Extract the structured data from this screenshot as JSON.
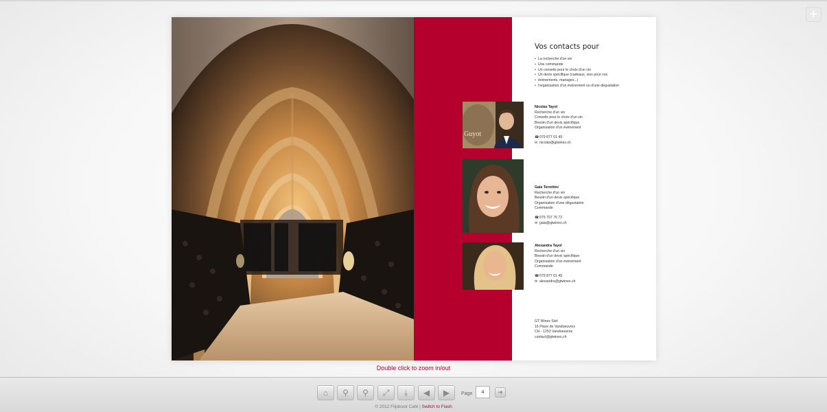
{
  "viewer": {
    "zoom_hint": "Double click to zoom in/out",
    "page_label": "Page",
    "page_value": "4",
    "footer_copyright": "© 2012 Flipbook Café",
    "footer_separator": "|",
    "footer_link": "Switch to Flash",
    "toolbar_buttons": [
      {
        "name": "home",
        "icon": "home-icon"
      },
      {
        "name": "zoom-in",
        "icon": "zoom-in-icon"
      },
      {
        "name": "zoom-out",
        "icon": "zoom-out-icon"
      },
      {
        "name": "fullscreen",
        "icon": "fullscreen-icon"
      },
      {
        "name": "download",
        "icon": "download-icon"
      },
      {
        "name": "previous-page",
        "icon": "arrow-left-icon"
      },
      {
        "name": "next-page",
        "icon": "arrow-right-icon"
      }
    ]
  },
  "brochure": {
    "title": "Vos contacts pour",
    "bullets": [
      "La recherche d'un vin",
      "Une commande",
      "Un conseils pour le choix d'un vin",
      "Un devis spécifique (cadeaux, vins pour vos",
      "événements, mariages...)",
      "l'organisation d'un événement ou d'une dégustation"
    ],
    "contacts": [
      {
        "name": "Nicolas Tayol",
        "roles": [
          "Recherche d'un vin",
          "Conseils pour le choix d'un vin",
          "Besoin d'un devis spécifique",
          "Organisation d'un événement"
        ],
        "phone": "079 877 01 49",
        "email": "nicolas@gtwines.ch"
      },
      {
        "name": "Gaïa Terrettini",
        "roles": [
          "Recherche d'un vin",
          "Besoin d'un devis spécifique",
          "Organisation d'une dégustation",
          "Commande"
        ],
        "phone": "079 707 76 72",
        "email": "gaia@gtwines.ch"
      },
      {
        "name": "Alexandra Tayol",
        "roles": [
          "Recherche d'un vin",
          "Besoin d'un devis spécifique",
          "Organisation d'un événement",
          "Commande"
        ],
        "phone": "079 877 01 49",
        "email": "alexandra@gtwines.ch"
      }
    ],
    "address": [
      "GT Wines Sàrl",
      "16 Place de Vandoeuvres",
      "CH - 1253 Vandoeuvres",
      "contact@gtwines.ch"
    ],
    "photo_label": "Guyot"
  },
  "colors": {
    "accent": "#b5002d"
  }
}
